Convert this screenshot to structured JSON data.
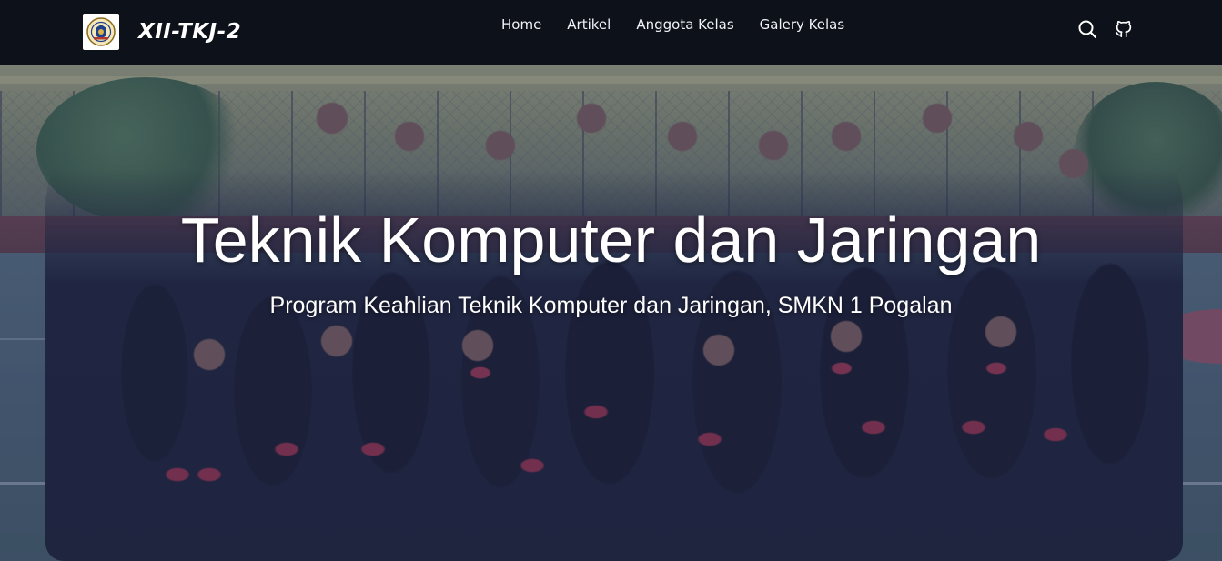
{
  "brand": {
    "name": "XII-TKJ-2",
    "logo_icon": "school-emblem-icon"
  },
  "nav": {
    "links": [
      {
        "label": "Home"
      },
      {
        "label": "Artikel"
      },
      {
        "label": "Anggota Kelas"
      },
      {
        "label": "Galery Kelas"
      }
    ],
    "icons": [
      "search-icon",
      "github-icon"
    ]
  },
  "hero": {
    "title": "Teknik Komputer dan Jaringan",
    "subtitle": "Program Keahlian Teknik Komputer dan Jaringan, SMKN 1 Pogalan"
  },
  "colors": {
    "navbar_bg": "#0a0e16",
    "nav_text": "#f1f3f7",
    "hero_overlay": "#262a5a",
    "hero_text": "#ffffff"
  }
}
